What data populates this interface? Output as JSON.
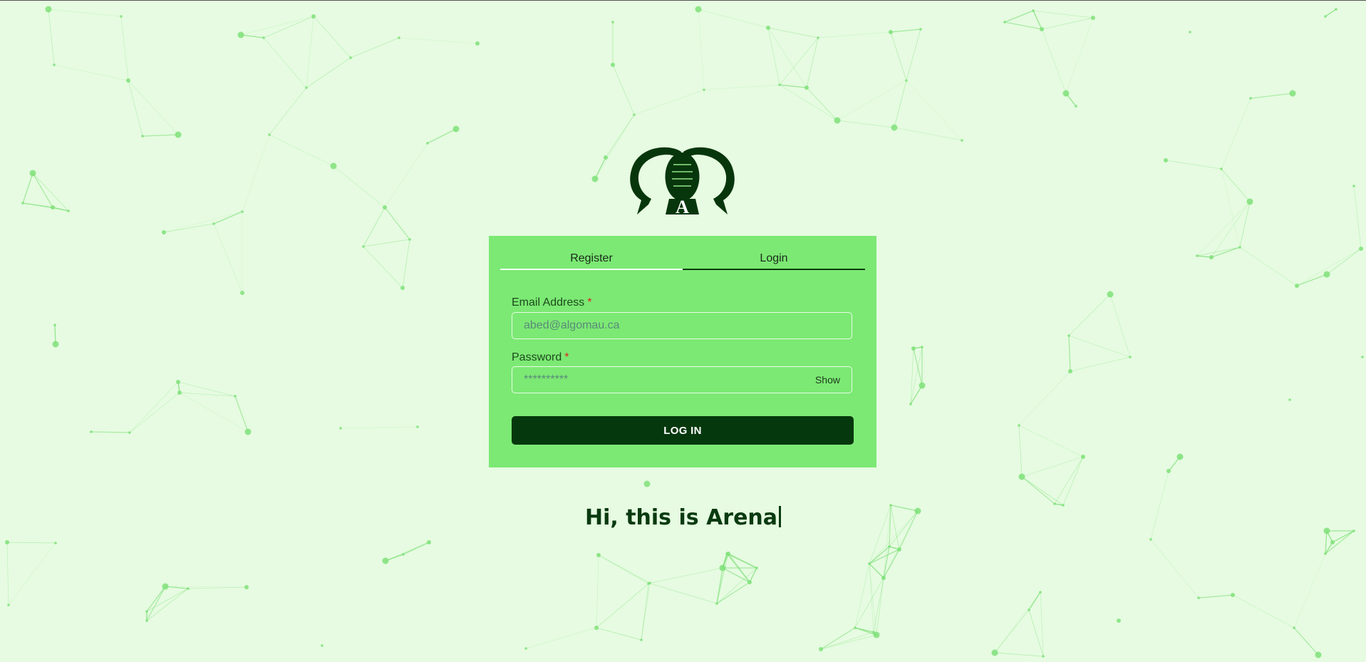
{
  "colors": {
    "background": "#e6fbe1",
    "card": "#7ce974",
    "accent_dark": "#06380d",
    "network": "#7fe079",
    "required": "#e02020"
  },
  "logo": {
    "icon": "arena-speech-bubbles-logo",
    "letter": "A"
  },
  "tabs": [
    {
      "label": "Register",
      "active": false
    },
    {
      "label": "Login",
      "active": true
    }
  ],
  "form": {
    "email": {
      "label": "Email Address",
      "required_mark": "*",
      "placeholder": "abed@algomau.ca"
    },
    "password": {
      "label": "Password",
      "required_mark": "*",
      "placeholder": "**********",
      "toggle_label": "Show"
    },
    "submit_label": "LOG IN"
  },
  "tagline": "Hi, this is Arena"
}
